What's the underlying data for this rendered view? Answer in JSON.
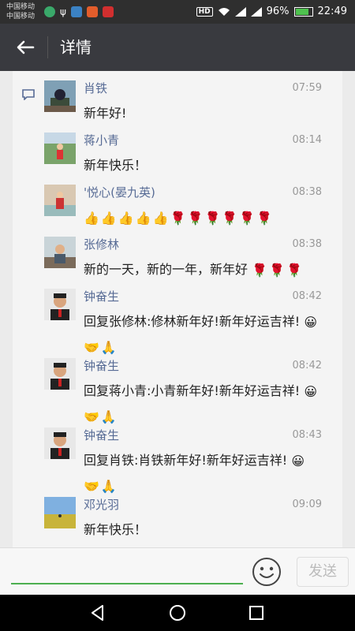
{
  "status": {
    "carrier1": "中国移动",
    "carrier2": "中国移动",
    "battery": "96%",
    "time": "22:49",
    "hd": "HD"
  },
  "header": {
    "title": "详情"
  },
  "comments": [
    {
      "name": "肖铁",
      "time": "07:59",
      "text": "新年好!"
    },
    {
      "name": "蒋小青",
      "time": "08:14",
      "text": "新年快乐！"
    },
    {
      "name": "'悦心(晏九英)",
      "time": "08:38",
      "text": ""
    },
    {
      "name": "张修林",
      "time": "08:38",
      "text": "新的一天，新的一年，新年好"
    },
    {
      "name": "钟奋生",
      "time": "08:42",
      "text": "回复张修林:修林新年好!新年好运吉祥!"
    },
    {
      "name": "钟奋生",
      "time": "08:42",
      "text": "回复蒋小青:小青新年好!新年好运吉祥!"
    },
    {
      "name": "钟奋生",
      "time": "08:43",
      "text": "回复肖铁:肖铁新年好!新年好运吉祥!"
    },
    {
      "name": "邓光羽",
      "time": "09:09",
      "text": "新年快乐！"
    }
  ],
  "composer": {
    "send_label": "发送",
    "placeholder": ""
  },
  "icons": {
    "back": "back-arrow-icon",
    "comment": "comment-icon",
    "emoji": "smile-icon"
  }
}
